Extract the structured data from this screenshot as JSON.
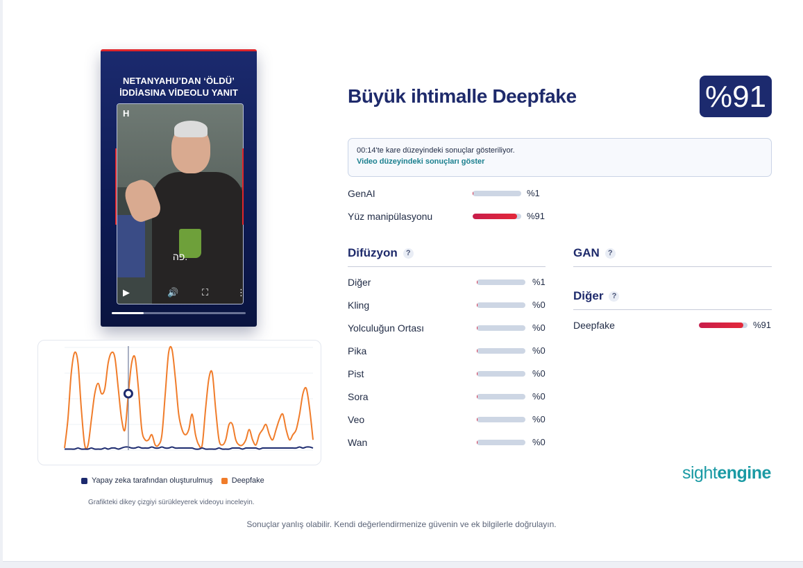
{
  "video": {
    "title_line1": "NETANYAHU’DAN ‘ÖLDÜ’",
    "title_line2": "İDDİASINA VİDEOLU YANIT",
    "logo": "H",
    "subtitle": "פה.",
    "progress": 0.24,
    "icons": [
      "play-icon",
      "volume-icon",
      "fullscreen-icon",
      "more-vertical-icon"
    ]
  },
  "result": {
    "headline": "Büyük ihtimalle Deepfake",
    "score": "%91"
  },
  "info": {
    "frame_note": "00:14'te kare düzeyindeki sonuçlar gösteriliyor.",
    "video_link": "Video düzeyindeki sonuçları göster"
  },
  "top_scores": [
    {
      "label": "GenAI",
      "pct": "%1",
      "value": 1
    },
    {
      "label": "Yüz manipülasyonu",
      "pct": "%91",
      "value": 91
    }
  ],
  "diffusion": {
    "title": "Difüzyon",
    "items": [
      {
        "label": "Diğer",
        "pct": "%1",
        "value": 1
      },
      {
        "label": "Kling",
        "pct": "%0",
        "value": 0
      },
      {
        "label": "Yolculuğun Ortası",
        "pct": "%0",
        "value": 0
      },
      {
        "label": "Pika",
        "pct": "%0",
        "value": 0
      },
      {
        "label": "Pist",
        "pct": "%0",
        "value": 0
      },
      {
        "label": "Sora",
        "pct": "%0",
        "value": 0
      },
      {
        "label": "Veo",
        "pct": "%0",
        "value": 0
      },
      {
        "label": "Wan",
        "pct": "%0",
        "value": 0
      }
    ]
  },
  "gan": {
    "title": "GAN"
  },
  "other": {
    "title": "Diğer",
    "items": [
      {
        "label": "Deepfake",
        "pct": "%91",
        "value": 91
      }
    ]
  },
  "qmark": "?",
  "chart": {
    "legend_ai": "Yapay zeka tarafından oluşturulmuş",
    "legend_deepfake": "Deepfake",
    "hint": "Grafikteki dikey çizgiyi sürükleyerek videoyu inceleyin.",
    "color_ai": "#1c2a6e",
    "color_deepfake": "#f07c2a"
  },
  "chart_data": {
    "type": "line",
    "title": "",
    "xlabel": "",
    "ylabel": "",
    "ylim": [
      0,
      1
    ],
    "grid": true,
    "legend_placement": "bottom",
    "cursor_index": 19,
    "series": [
      {
        "name": "Yapay zeka tarafından oluşturulmuş",
        "values": [
          0.01,
          0.01,
          0.01,
          0.01,
          0.02,
          0.01,
          0.01,
          0.01,
          0.02,
          0.01,
          0.01,
          0.01,
          0.02,
          0.01,
          0.02,
          0.02,
          0.01,
          0.02,
          0.03,
          0.03,
          0.02,
          0.02,
          0.03,
          0.02,
          0.02,
          0.02,
          0.03,
          0.02,
          0.02,
          0.03,
          0.02,
          0.02,
          0.03,
          0.02,
          0.02,
          0.02,
          0.02,
          0.02,
          0.02,
          0.01,
          0.01,
          0.02,
          0.01,
          0.01,
          0.01,
          0.01,
          0.02,
          0.01,
          0.01,
          0.01,
          0.02,
          0.02,
          0.02,
          0.01,
          0.02,
          0.02,
          0.02,
          0.02,
          0.01,
          0.02,
          0.02,
          0.02,
          0.02,
          0.02,
          0.02,
          0.02,
          0.02,
          0.02,
          0.02,
          0.02,
          0.03,
          0.02,
          0.03,
          0.03,
          0.02
        ]
      },
      {
        "name": "Deepfake",
        "values": [
          0.02,
          0.3,
          0.75,
          0.95,
          0.85,
          0.4,
          0.05,
          0.05,
          0.3,
          0.55,
          0.65,
          0.55,
          0.6,
          0.85,
          0.95,
          0.9,
          0.6,
          0.3,
          0.2,
          0.55,
          0.85,
          0.9,
          0.6,
          0.2,
          0.1,
          0.1,
          0.15,
          0.05,
          0.05,
          0.15,
          0.55,
          0.95,
          0.98,
          0.7,
          0.35,
          0.2,
          0.15,
          0.2,
          0.35,
          0.15,
          0.05,
          0.05,
          0.4,
          0.7,
          0.75,
          0.4,
          0.1,
          0.05,
          0.1,
          0.25,
          0.25,
          0.1,
          0.05,
          0.05,
          0.1,
          0.2,
          0.1,
          0.05,
          0.15,
          0.2,
          0.25,
          0.15,
          0.1,
          0.2,
          0.3,
          0.35,
          0.2,
          0.1,
          0.15,
          0.2,
          0.35,
          0.55,
          0.6,
          0.4,
          0.1
        ]
      }
    ]
  }
}
